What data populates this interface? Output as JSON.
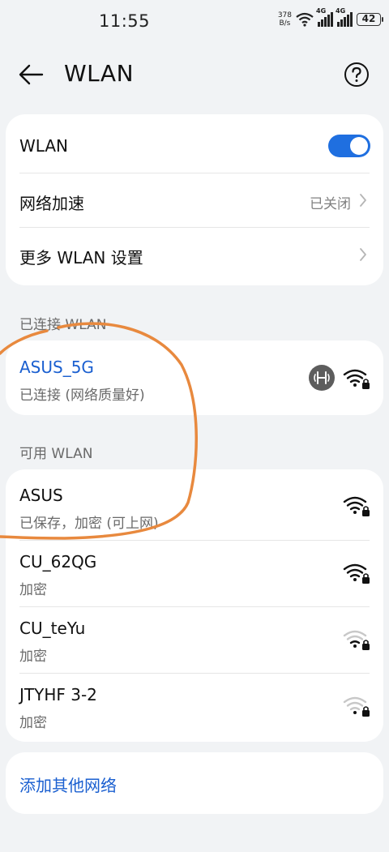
{
  "status_bar": {
    "time": "11:55",
    "net_speed_value": "378",
    "net_speed_unit": "B/s",
    "signal1_tag": "4G",
    "signal2_tag": "4G",
    "battery": "42"
  },
  "header": {
    "title": "WLAN"
  },
  "settings": {
    "wlan_label": "WLAN",
    "wlan_enabled": true,
    "accel_label": "网络加速",
    "accel_value": "已关闭",
    "more_label": "更多 WLAN 设置"
  },
  "connected": {
    "section_title": "已连接 WLAN",
    "network": {
      "name": "ASUS_5G",
      "status": "已连接 (网络质量好)"
    }
  },
  "available": {
    "section_title": "可用 WLAN",
    "networks": [
      {
        "name": "ASUS",
        "status": "已保存，加密 (可上网)"
      },
      {
        "name": "CU_62QG",
        "status": "加密"
      },
      {
        "name": "CU_teYu",
        "status": "加密"
      },
      {
        "name": "JTYHF 3-2",
        "status": "加密"
      }
    ]
  },
  "add_network_label": "添加其他网络",
  "colors": {
    "accent": "#1f6fe0",
    "link": "#1a5fd0",
    "annotation": "#e8893e"
  }
}
